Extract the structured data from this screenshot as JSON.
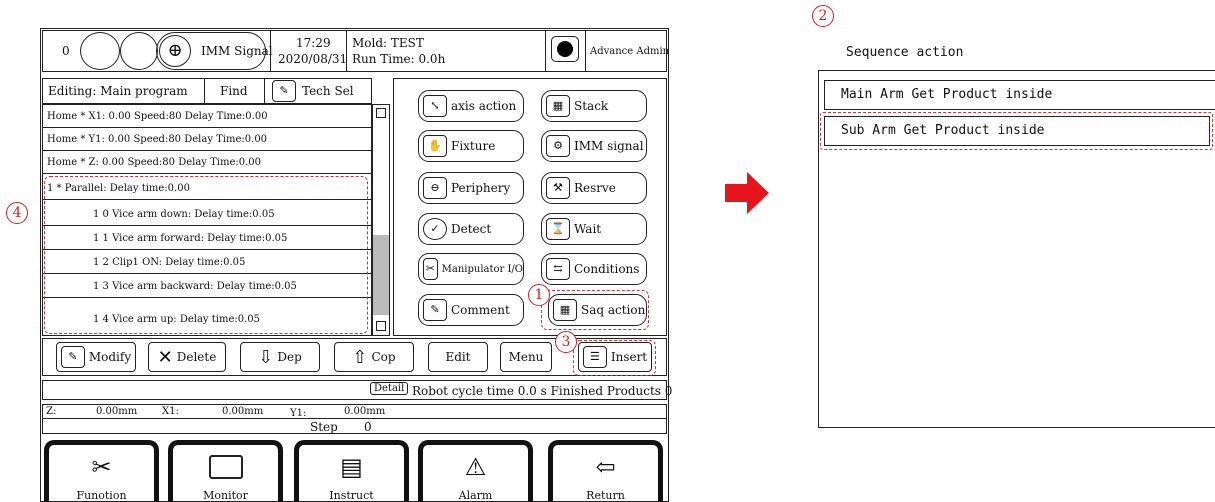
{
  "status_bar": {
    "counter": "0",
    "imm_signal": "IMM Signal",
    "time": "17:29",
    "date": "2020/08/31",
    "mold": "Mold: TEST",
    "run_time": "Run Time: 0.0h",
    "user": "Advance Admin"
  },
  "program": {
    "editing": "Editing: Main program",
    "find": "Find",
    "tech_sel": "Tech Sel",
    "rows": [
      "Home   * X1: 0.00 Speed:80  Delay Time:0.00",
      "Home   * Y1: 0.00 Speed:80  Delay Time:0.00",
      "Home   * Z: 0.00 Speed:80  Delay Time:0.00",
      "1   * Parallel: Delay time:0.00",
      "1  0  Vice arm down: Delay time:0.05",
      "1  1  Vice arm forward: Delay time:0.05",
      "1  2  Clip1 ON: Delay time:0.05",
      "1  3  Vice arm backward: Delay time:0.05",
      "1  4  Vice arm up: Delay time:0.05"
    ]
  },
  "actions": {
    "axis_action": "axis action",
    "stack": "Stack",
    "fixture": "Fixture",
    "imm_signal": "IMM signal",
    "periphery": "Periphery",
    "reserve": "Resrve",
    "detect": "Detect",
    "wait": "Wait",
    "manipulator_io": "Manipulator I/O",
    "conditions": "Conditions",
    "comment": "Comment",
    "saq_action": "Saq action"
  },
  "toolbar": {
    "modify": "Modify",
    "delete": "Delete",
    "dep": "Dep",
    "cop": "Cop",
    "edit": "Edit",
    "menu": "Menu",
    "insert": "Insert"
  },
  "info": {
    "detail": "Detail",
    "cycle": "Robot cycle time 0.0 s Finished Products  0",
    "z_label": "Z:",
    "z_value": "0.00mm",
    "x1_label": "X1:",
    "x1_value": "0.00mm",
    "y1_label": "Y1:",
    "y1_value": "0.00mm",
    "step_label": "Step",
    "step_value": "0"
  },
  "nav": {
    "function": "Funotion",
    "monitor": "Monitor",
    "instruct": "Instruct",
    "alarm": "Alarm",
    "return": "Return"
  },
  "sequence": {
    "title": "Sequence action",
    "items": [
      "Main Arm Get Product inside",
      "Sub Arm Get Product inside"
    ]
  },
  "markers": {
    "m1": "1",
    "m2": "2",
    "m3": "3",
    "m4": "4"
  },
  "colors": {
    "annotation": "#cc2222",
    "arrow": "#e8141b"
  }
}
